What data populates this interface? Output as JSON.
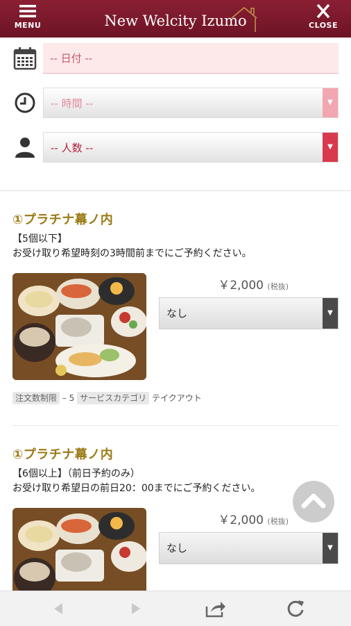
{
  "header": {
    "menu_label": "MENU",
    "title": "New Welcity Izumo",
    "close_label": "CLOSE"
  },
  "form": {
    "date_placeholder": "-- 日付 --",
    "time_placeholder": "-- 時間 --",
    "people_placeholder": "-- 人数 --"
  },
  "products": [
    {
      "title": "①プラチナ幕ノ内",
      "line1": "【5個以下】",
      "line2": "お受け取り希望時刻の3時間前までにご予約ください。",
      "price": "￥2,000",
      "tax": "(税抜)",
      "select_value": "なし",
      "meta_order_limit_label": "注文数制限",
      "meta_order_limit_value": "– 5",
      "meta_category_label": "サービスカテゴリ",
      "meta_category_value": "テイクアウト"
    },
    {
      "title": "①プラチナ幕ノ内",
      "line1": "【6個以上】（前日予約のみ）",
      "line2": "お受け取り希望日の前日20：00までにご予約ください。",
      "price": "￥2,000",
      "tax": "(税抜)",
      "select_value": "なし"
    }
  ],
  "colors": {
    "header_bg": "#7a1a2e",
    "accent_red": "#d8394e",
    "title_gold": "#9a7a14"
  },
  "icons": {
    "menu": "hamburger-icon",
    "close": "close-icon",
    "date": "calendar-icon",
    "time": "clock-icon",
    "people": "person-icon",
    "scroll_top": "chevron-up-icon",
    "back": "back-arrow-icon",
    "forward": "forward-arrow-icon",
    "share": "share-icon",
    "reload": "reload-icon"
  }
}
